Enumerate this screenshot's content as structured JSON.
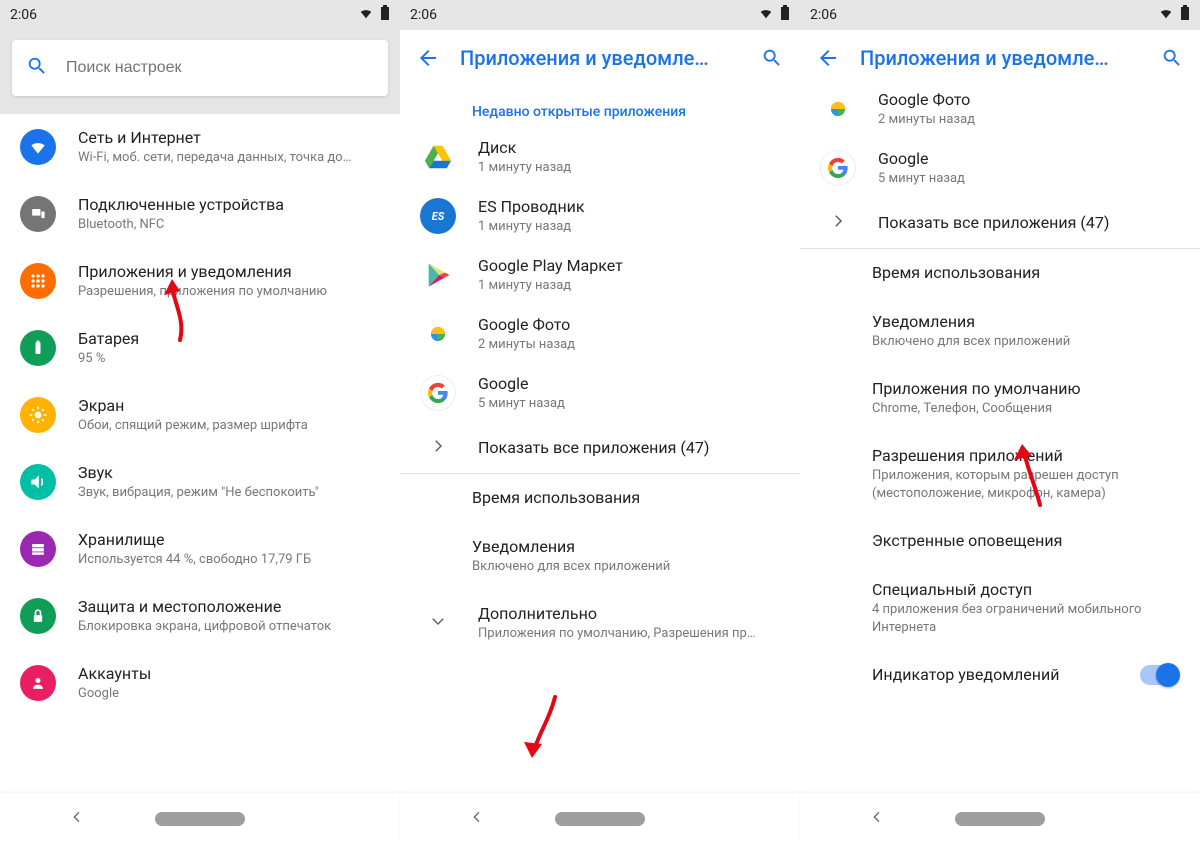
{
  "statusbar": {
    "time": "2:06"
  },
  "panel1": {
    "search_placeholder": "Поиск настроек",
    "items": [
      {
        "title": "Сеть и Интернет",
        "sub": "Wi-Fi, моб. сети, передача данных, точка до…",
        "color": "#1a73e8",
        "icon": "wifi"
      },
      {
        "title": "Подключенные устройства",
        "sub": "Bluetooth, NFC",
        "color": "#777",
        "icon": "devices"
      },
      {
        "title": "Приложения и уведомления",
        "sub": "Разрешения, приложения по умолчанию",
        "color": "#ff6d00",
        "icon": "apps"
      },
      {
        "title": "Батарея",
        "sub": "95 %",
        "color": "#0f9d58",
        "icon": "battery"
      },
      {
        "title": "Экран",
        "sub": "Обои, спящий режим, размер шрифта",
        "color": "#ffb300",
        "icon": "display"
      },
      {
        "title": "Звук",
        "sub": "Звук, вибрация, режим \"Не беспокоить\"",
        "color": "#00bfa5",
        "icon": "sound"
      },
      {
        "title": "Хранилище",
        "sub": "Используется 44 %, свободно 17,79 ГБ",
        "color": "#9c27b0",
        "icon": "storage"
      },
      {
        "title": "Защита и местоположение",
        "sub": "Блокировка экрана, цифровой отпечаток",
        "color": "#0f9d58",
        "icon": "security"
      },
      {
        "title": "Аккаунты",
        "sub": "Google",
        "color": "#e91e63",
        "icon": "account"
      }
    ]
  },
  "panel2": {
    "title": "Приложения и уведомле…",
    "recent_header": "Недавно открытые приложения",
    "apps": [
      {
        "name": "Диск",
        "sub": "1 минуту назад",
        "icon": "drive"
      },
      {
        "name": "ES Проводник",
        "sub": "1 минуту назад",
        "icon": "es"
      },
      {
        "name": "Google Play Маркет",
        "sub": "1 минуту назад",
        "icon": "play"
      },
      {
        "name": "Google Фото",
        "sub": "2 минуты назад",
        "icon": "photos"
      },
      {
        "name": "Google",
        "sub": "5 минут назад",
        "icon": "google"
      }
    ],
    "show_all": "Показать все приложения (47)",
    "screen_time": "Время использования",
    "notifications_title": "Уведомления",
    "notifications_sub": "Включено для всех приложений",
    "advanced_title": "Дополнительно",
    "advanced_sub": "Приложения по умолчанию, Разрешения пр…"
  },
  "panel3": {
    "title": "Приложения и уведомле…",
    "top_apps": [
      {
        "name": "Google Фото",
        "sub": "2 минуты назад",
        "icon": "photos"
      },
      {
        "name": "Google",
        "sub": "5 минут назад",
        "icon": "google"
      }
    ],
    "show_all": "Показать все приложения (47)",
    "screen_time": "Время использования",
    "notifications_title": "Уведомления",
    "notifications_sub": "Включено для всех приложений",
    "default_apps_title": "Приложения по умолчанию",
    "default_apps_sub": "Chrome, Телефон, Сообщения",
    "app_perms_title": "Разрешения приложений",
    "app_perms_sub": "Приложения, которым разрешен доступ (местоположение, микрофон, камера)",
    "emergency": "Экстренные оповещения",
    "special_title": "Специальный доступ",
    "special_sub": "4 приложения без ограничений мобильного Интернета",
    "indicator": "Индикатор уведомлений"
  }
}
